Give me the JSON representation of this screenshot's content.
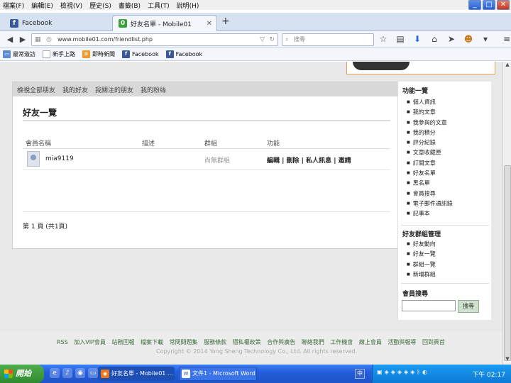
{
  "menu": [
    "檔案(F)",
    "編輯(E)",
    "檢視(V)",
    "歷史(S)",
    "書籤(B)",
    "工具(T)",
    "說明(H)"
  ],
  "tabs": [
    {
      "label": "Facebook",
      "icon": "facebook-icon"
    },
    {
      "label": "好友名單 - Mobile01",
      "icon": "mobile01-icon"
    }
  ],
  "address": {
    "url": "www.mobile01.com/friendlist.php"
  },
  "search": {
    "placeholder": "搜尋"
  },
  "bookmarks": [
    "最常造訪",
    "新手上路",
    "即時新聞",
    "Facebook",
    "Facebook"
  ],
  "page": {
    "subnav": [
      "檢視全部朋友",
      "我的好友",
      "我關注的朋友",
      "我的粉絲"
    ],
    "title": "好友一覽",
    "columns": [
      "會員名稱",
      "描述",
      "群組",
      "功能"
    ],
    "rows": [
      {
        "name": "mia9119",
        "desc": "",
        "group": "尚無群組",
        "actions": "編輯 | 刪除 | 私人訊息 | 邀請"
      }
    ],
    "pagination": "第 1 頁 (共1頁)"
  },
  "sidebar": {
    "section1_title": "功能一覽",
    "section1_items": [
      "個人資訊",
      "我的文章",
      "我參與的文章",
      "我的積分",
      "評分紀錄",
      "文章收藏匣",
      "訂閱文章",
      "好友名單",
      "黑名單",
      "會員搜尋",
      "電子郵件通訊錄",
      "記事本"
    ],
    "section2_title": "好友群組管理",
    "section2_items": [
      "好友動向",
      "好友一覽",
      "群組一覽",
      "新增群組"
    ],
    "section3_title": "會員搜尋",
    "search_button": "搜尋"
  },
  "footer": {
    "links": [
      "RSS",
      "加入VIP會員",
      "站務回報",
      "檔案下載",
      "常問問題集",
      "服務條款",
      "隱私權政策",
      "合作與廣告",
      "聯絡我們",
      "工作機會",
      "線上會員",
      "活動與報導",
      "回到頁首"
    ],
    "copyright": "Copyright © 2014 Yong Sheng Technology Co., Ltd. All rights reserved."
  },
  "taskbar": {
    "start": "開始",
    "tasks": [
      "好友名單 - Mobile01 ...",
      "文件1 - Microsoft Word"
    ],
    "clock": "下午 02:17"
  }
}
